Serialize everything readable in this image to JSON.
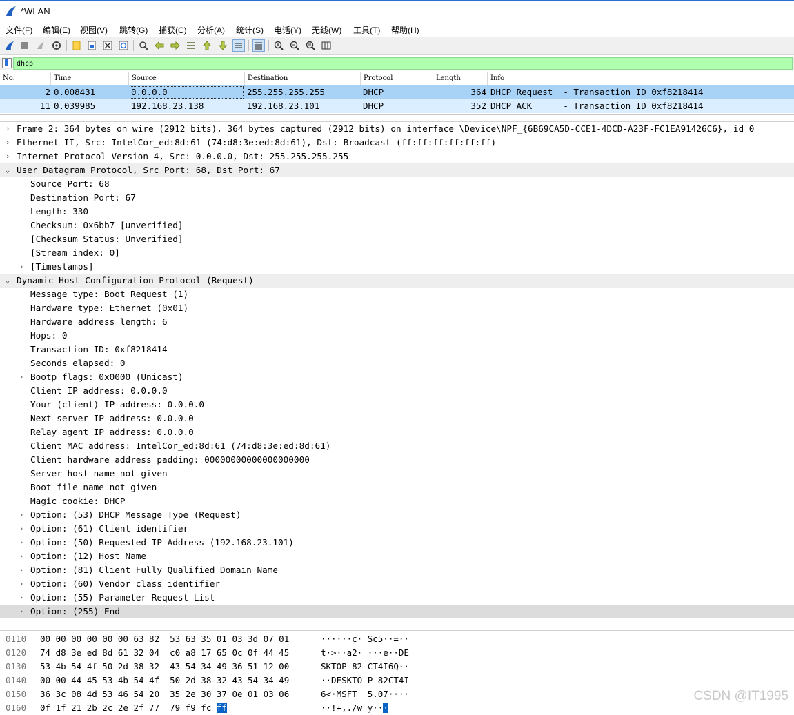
{
  "window": {
    "title": "*WLAN"
  },
  "menu": [
    "文件(F)",
    "编辑(E)",
    "视图(V)",
    "跳转(G)",
    "捕获(C)",
    "分析(A)",
    "统计(S)",
    "电话(Y)",
    "无线(W)",
    "工具(T)",
    "帮助(H)"
  ],
  "toolbar": {
    "icons": [
      "shark-fin-start-icon",
      "stop-icon",
      "restart-icon",
      "options-gear-icon",
      "open-file-icon",
      "save-file-icon",
      "close-file-icon",
      "reload-icon",
      "find-packet-icon",
      "go-back-icon",
      "go-forward-icon",
      "go-to-packet-icon",
      "go-first-icon",
      "go-last-icon",
      "autoscroll-icon",
      "colorize-icon",
      "zoom-in-icon",
      "zoom-out-icon",
      "normal-size-icon",
      "resize-columns-icon"
    ],
    "active": [
      "autoscroll-icon",
      "colorize-icon"
    ]
  },
  "filter": {
    "value": "dhcp"
  },
  "packet_list": {
    "columns": [
      "No.",
      "Time",
      "Source",
      "Destination",
      "Protocol",
      "Length",
      "Info"
    ],
    "rows": [
      {
        "no": "2",
        "time": "0.008431",
        "source": "0.0.0.0",
        "destination": "255.255.255.255",
        "protocol": "DHCP",
        "length": "364",
        "info": "DHCP Request  - Transaction ID 0xf8218414",
        "selected": true
      },
      {
        "no": "11",
        "time": "0.039985",
        "source": "192.168.23.138",
        "destination": "192.168.23.101",
        "protocol": "DHCP",
        "length": "352",
        "info": "DHCP ACK      - Transaction ID 0xf8218414",
        "selected": false
      }
    ]
  },
  "details": [
    {
      "indent": 0,
      "toggle": "collapsed",
      "text": "Frame 2: 364 bytes on wire (2912 bits), 364 bytes captured (2912 bits) on interface \\Device\\NPF_{6B69CA5D-CCE1-4DCD-A23F-FC1EA91426C6}, id 0"
    },
    {
      "indent": 0,
      "toggle": "collapsed",
      "text": "Ethernet II, Src: IntelCor_ed:8d:61 (74:d8:3e:ed:8d:61), Dst: Broadcast (ff:ff:ff:ff:ff:ff)"
    },
    {
      "indent": 0,
      "toggle": "collapsed",
      "text": "Internet Protocol Version 4, Src: 0.0.0.0, Dst: 255.255.255.255"
    },
    {
      "indent": 0,
      "toggle": "expanded",
      "text": "User Datagram Protocol, Src Port: 68, Dst Port: 67",
      "highlight": true
    },
    {
      "indent": 1,
      "toggle": "none",
      "text": "Source Port: 68"
    },
    {
      "indent": 1,
      "toggle": "none",
      "text": "Destination Port: 67"
    },
    {
      "indent": 1,
      "toggle": "none",
      "text": "Length: 330"
    },
    {
      "indent": 1,
      "toggle": "none",
      "text": "Checksum: 0x6bb7 [unverified]"
    },
    {
      "indent": 1,
      "toggle": "none",
      "text": "[Checksum Status: Unverified]"
    },
    {
      "indent": 1,
      "toggle": "none",
      "text": "[Stream index: 0]"
    },
    {
      "indent": 1,
      "toggle": "collapsed",
      "text": "[Timestamps]"
    },
    {
      "indent": 0,
      "toggle": "expanded",
      "text": "Dynamic Host Configuration Protocol (Request)",
      "highlight": true
    },
    {
      "indent": 1,
      "toggle": "none",
      "text": "Message type: Boot Request (1)"
    },
    {
      "indent": 1,
      "toggle": "none",
      "text": "Hardware type: Ethernet (0x01)"
    },
    {
      "indent": 1,
      "toggle": "none",
      "text": "Hardware address length: 6"
    },
    {
      "indent": 1,
      "toggle": "none",
      "text": "Hops: 0"
    },
    {
      "indent": 1,
      "toggle": "none",
      "text": "Transaction ID: 0xf8218414"
    },
    {
      "indent": 1,
      "toggle": "none",
      "text": "Seconds elapsed: 0"
    },
    {
      "indent": 1,
      "toggle": "collapsed",
      "text": "Bootp flags: 0x0000 (Unicast)"
    },
    {
      "indent": 1,
      "toggle": "none",
      "text": "Client IP address: 0.0.0.0"
    },
    {
      "indent": 1,
      "toggle": "none",
      "text": "Your (client) IP address: 0.0.0.0"
    },
    {
      "indent": 1,
      "toggle": "none",
      "text": "Next server IP address: 0.0.0.0"
    },
    {
      "indent": 1,
      "toggle": "none",
      "text": "Relay agent IP address: 0.0.0.0"
    },
    {
      "indent": 1,
      "toggle": "none",
      "text": "Client MAC address: IntelCor_ed:8d:61 (74:d8:3e:ed:8d:61)"
    },
    {
      "indent": 1,
      "toggle": "none",
      "text": "Client hardware address padding: 00000000000000000000"
    },
    {
      "indent": 1,
      "toggle": "none",
      "text": "Server host name not given"
    },
    {
      "indent": 1,
      "toggle": "none",
      "text": "Boot file name not given"
    },
    {
      "indent": 1,
      "toggle": "none",
      "text": "Magic cookie: DHCP"
    },
    {
      "indent": 1,
      "toggle": "collapsed",
      "text": "Option: (53) DHCP Message Type (Request)"
    },
    {
      "indent": 1,
      "toggle": "collapsed",
      "text": "Option: (61) Client identifier"
    },
    {
      "indent": 1,
      "toggle": "collapsed",
      "text": "Option: (50) Requested IP Address (192.168.23.101)"
    },
    {
      "indent": 1,
      "toggle": "collapsed",
      "text": "Option: (12) Host Name"
    },
    {
      "indent": 1,
      "toggle": "collapsed",
      "text": "Option: (81) Client Fully Qualified Domain Name"
    },
    {
      "indent": 1,
      "toggle": "collapsed",
      "text": "Option: (60) Vendor class identifier"
    },
    {
      "indent": 1,
      "toggle": "collapsed",
      "text": "Option: (55) Parameter Request List"
    },
    {
      "indent": 1,
      "toggle": "collapsed",
      "text": "Option: (255) End",
      "selected": true
    }
  ],
  "bytes": [
    {
      "offset": "0110",
      "hex": "00 00 00 00 00 00 63 82  53 63 35 01 03 3d 07 01",
      "ascii": "······c· Sc5··=··"
    },
    {
      "offset": "0120",
      "hex": "74 d8 3e ed 8d 61 32 04  c0 a8 17 65 0c 0f 44 45",
      "ascii": "t·>··a2· ···e··DE"
    },
    {
      "offset": "0130",
      "hex": "53 4b 54 4f 50 2d 38 32  43 54 34 49 36 51 12 00",
      "ascii": "SKTOP-82 CT4I6Q··"
    },
    {
      "offset": "0140",
      "hex": "00 00 44 45 53 4b 54 4f  50 2d 38 32 43 54 34 49",
      "ascii": "··DESKTO P-82CT4I"
    },
    {
      "offset": "0150",
      "hex": "36 3c 08 4d 53 46 54 20  35 2e 30 37 0e 01 03 06",
      "ascii": "6<·MSFT  5.07····"
    },
    {
      "offset": "0160",
      "hex": "0f 1f 21 2b 2c 2e 2f 77  79 f9 fc ",
      "hex_sel": "ff",
      "ascii": "··!+,./w y··",
      "ascii_sel": "·"
    }
  ],
  "watermark": "CSDN @IT1995",
  "colors": {
    "accent": "#2a6fd6",
    "filter_bg": "#afffaf",
    "row_selected": "#a9d2f7",
    "row_normal": "#daeeff",
    "byte_selected": "#0a64c8"
  }
}
